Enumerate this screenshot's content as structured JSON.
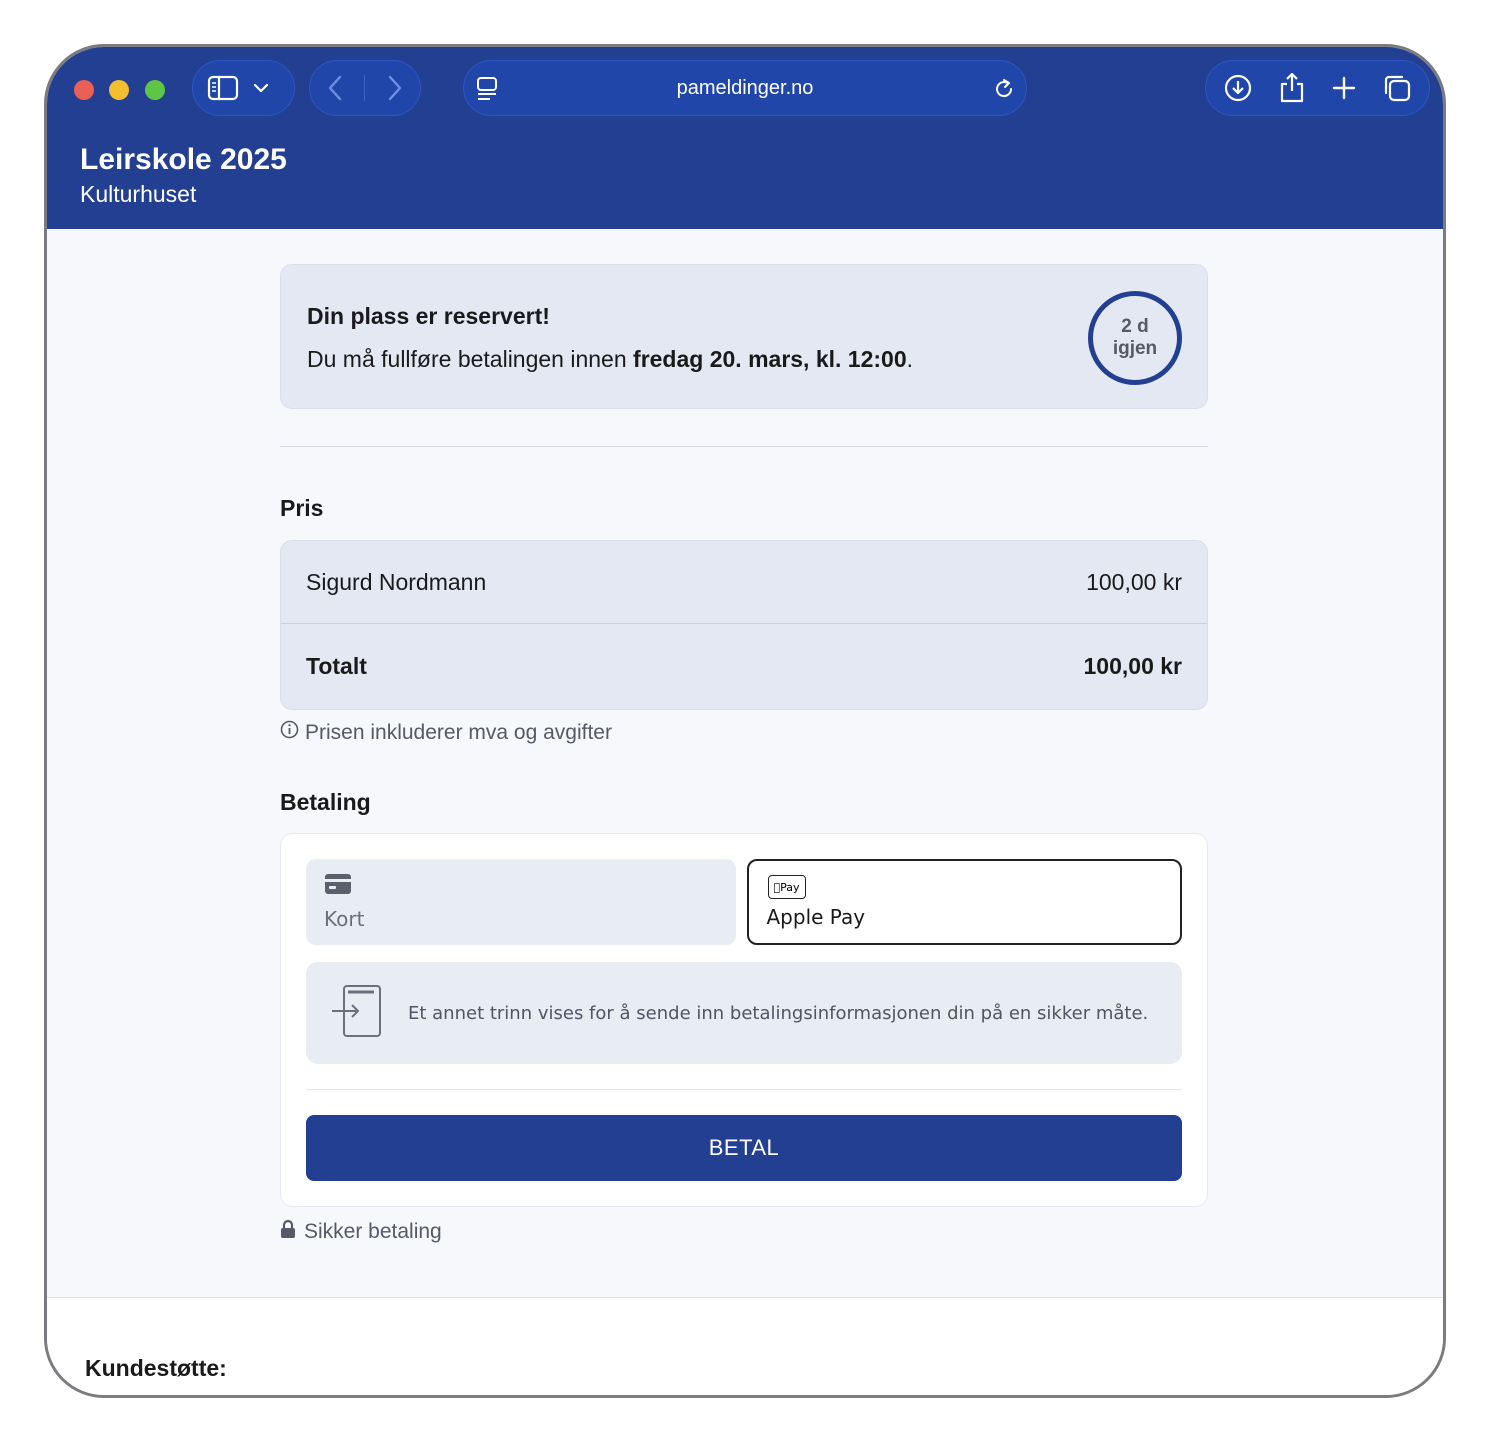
{
  "browser": {
    "url": "pameldinger.no"
  },
  "header": {
    "title": "Leirskole 2025",
    "subtitle": "Kulturhuset"
  },
  "notice": {
    "title": "Din plass er reservert!",
    "text_prefix": "Du må fullføre betalingen innen ",
    "deadline": "fredag 20. mars, kl. 12:00",
    "text_suffix": ".",
    "countdown_value": "2 d",
    "countdown_label": "igjen"
  },
  "price": {
    "title": "Pris",
    "rows": [
      {
        "name": "Sigurd Nordmann",
        "amount": "100,00 kr"
      }
    ],
    "total_label": "Totalt",
    "total_amount": "100,00 kr",
    "vat_note": "Prisen inkluderer mva og avgifter"
  },
  "payment": {
    "title": "Betaling",
    "methods": [
      {
        "label": "Kort",
        "icon": "credit-card-icon",
        "selected": false
      },
      {
        "label": "Apple Pay",
        "icon": "apple-pay-icon",
        "badge": "Pay",
        "selected": true
      }
    ],
    "redirect_info": "Et annet trinn vises for å sende inn betalingsinformasjonen din på en sikker måte.",
    "pay_button": "BETAL",
    "secure_note": "Sikker betaling"
  },
  "footer": {
    "support_label": "Kundestøtte:"
  },
  "colors": {
    "brand": "#233f92",
    "panel": "#e3e8f2",
    "background": "#f6f8fc"
  }
}
